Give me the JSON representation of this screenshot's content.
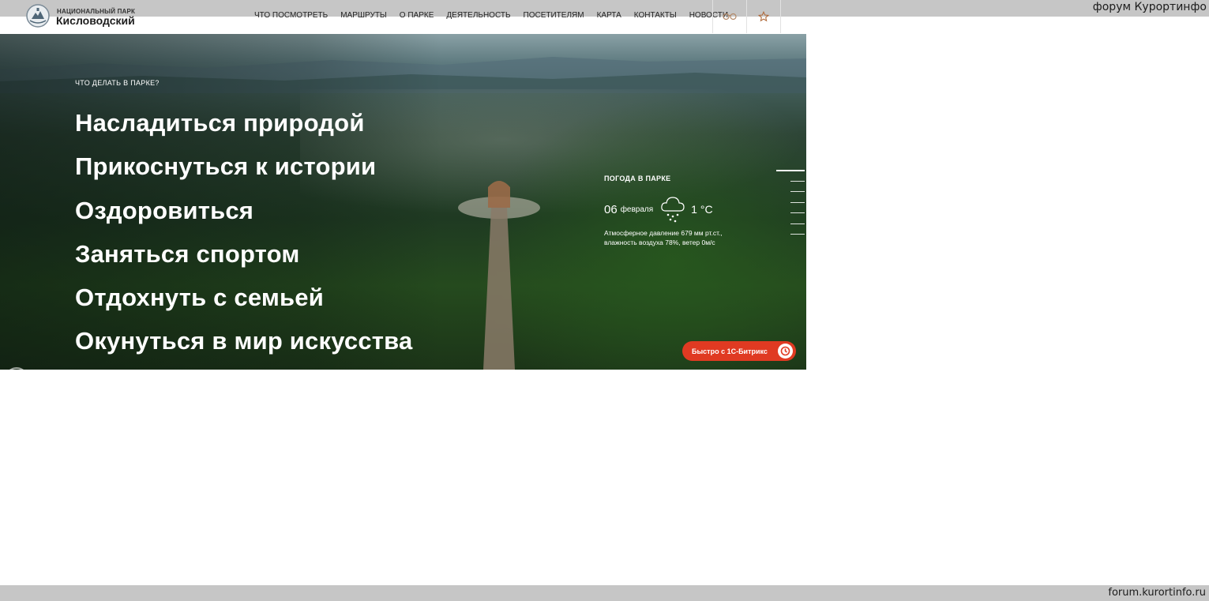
{
  "watermark": {
    "top": "форум Курортинфо",
    "bottom": "forum.kurortinfo.ru"
  },
  "header": {
    "brand_top": "НАЦИОНАЛЬНЫЙ ПАРК",
    "brand_name": "Кисловодский",
    "nav": [
      "ЧТО ПОСМОТРЕТЬ",
      "МАРШРУТЫ",
      "О ПАРКЕ",
      "ДЕЯТЕЛЬНОСТЬ",
      "ПОСЕТИТЕЛЯМ",
      "КАРТА",
      "КОНТАКТЫ",
      "НОВОСТИ"
    ],
    "icons": [
      "glasses-icon",
      "star-icon",
      "logo-emblem-icon"
    ]
  },
  "hero": {
    "kicker": "ЧТО ДЕЛАТЬ В ПАРКЕ?",
    "items": [
      "Насладиться природой",
      "Прикоснуться к истории",
      "Оздоровиться",
      "Заняться спортом",
      "Отдохнуть с семьей",
      "Окунуться в мир искусства"
    ]
  },
  "weather": {
    "title": "ПОГОДА В ПАРКЕ",
    "day": "06",
    "month": "февраля",
    "temp": "1 °C",
    "icon": "snow-cloud-icon",
    "line1": "Атмосферное давление 679 мм рт.ст.,",
    "line2": "влажность воздуха 78%, ветер 0м/с"
  },
  "slider": {
    "count": 7,
    "active_index": 0
  },
  "badge": {
    "label": "Быстро с 1С-Битрикс"
  },
  "colors": {
    "badge_red": "#e03a22",
    "strip_grey": "#c6c6c6"
  }
}
